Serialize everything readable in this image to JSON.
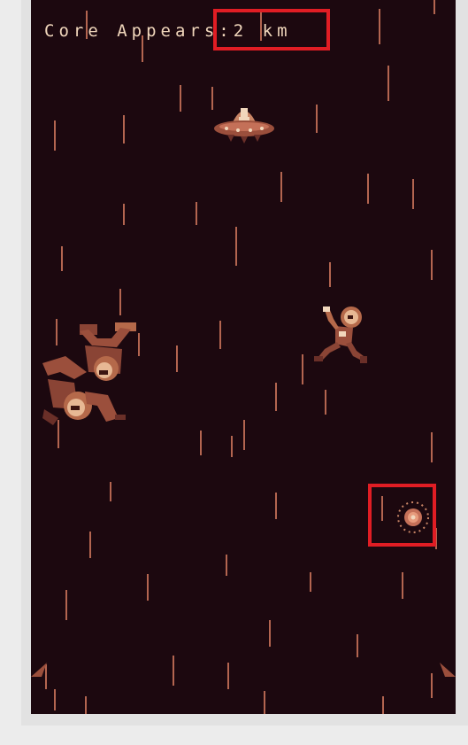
{
  "hud": {
    "label": "Core Appears:",
    "value": "2",
    "unit": "km"
  },
  "colors": {
    "background": "#1c080f",
    "rain": "#c47058",
    "sprite_light": "#f1d7bc",
    "sprite_mid": "#b5694a",
    "sprite_dark": "#6a2f28",
    "highlight": "#e01d24"
  },
  "sprites": {
    "ufo": "ufo-enemy",
    "astronaut_right": "astronaut-right",
    "astronaut_left": "astronaut-left-pair",
    "core_orb": "core-orb"
  }
}
